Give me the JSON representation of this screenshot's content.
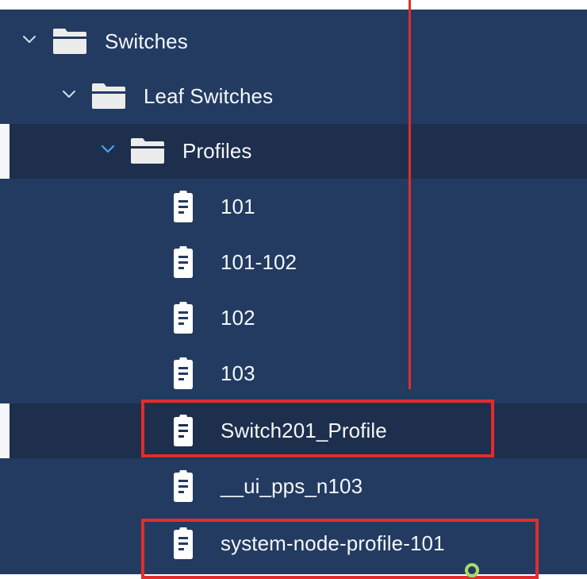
{
  "colors": {
    "panel_bg": "#233b61",
    "selected_row_bg": "#1d2f4d",
    "text": "#f4f7fb",
    "chevron": "#d5deea",
    "chevron_selected": "#4aa3f2",
    "folder": "#ececec",
    "file": "#ffffff",
    "highlight": "#e32c2c",
    "status": "#a8d96a"
  },
  "tree": {
    "switches": {
      "label": "Switches",
      "icon": "folder-icon",
      "expanded": true
    },
    "leaf_switches": {
      "label": "Leaf Switches",
      "icon": "folder-icon",
      "expanded": true
    },
    "profiles": {
      "label": "Profiles",
      "icon": "folder-icon",
      "expanded": true,
      "selected": true
    },
    "profile_items": [
      {
        "label": "101",
        "icon": "document-icon"
      },
      {
        "label": "101-102",
        "icon": "document-icon"
      },
      {
        "label": "102",
        "icon": "document-icon"
      },
      {
        "label": "103",
        "icon": "document-icon"
      },
      {
        "label": "Switch201_Profile",
        "icon": "document-icon",
        "selected": true,
        "highlighted": true
      },
      {
        "label": "__ui_pps_n103",
        "icon": "document-icon"
      },
      {
        "label": "system-node-profile-101",
        "icon": "document-icon",
        "highlighted": true
      }
    ]
  }
}
